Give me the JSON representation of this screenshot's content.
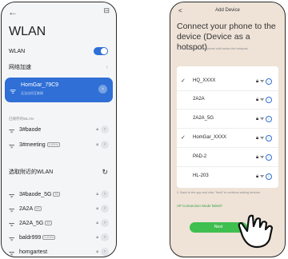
{
  "left": {
    "back_glyph": "←",
    "scan_glyph": "⊟",
    "title": "WLAN",
    "wlan_row_label": "WLAN",
    "accel_label": "网络加速",
    "connected": {
      "ssid": "HomGar_79C9",
      "sub": "无法访问互联网"
    },
    "saved_label": "已保存的WLAN",
    "saved": [
      {
        "name": "3#baode",
        "badge": ""
      },
      {
        "name": "3#meeting",
        "badge": "2.4GHz"
      }
    ],
    "nearby_label": "选取附近的WLAN",
    "nearby": [
      {
        "name": "3#baode_5G",
        "badge": "5G"
      },
      {
        "name": "2A2A",
        "badge": "5G"
      },
      {
        "name": "2A2A_5G",
        "badge": "5G"
      },
      {
        "name": "baldr999",
        "badge": "2.4GHz"
      },
      {
        "name": "homgartest",
        "badge": ""
      }
    ]
  },
  "right": {
    "header": "Add Device",
    "back_glyph": "<",
    "title": "Connect your phone to the device (Device as a hotspot)",
    "step1": "1. Please connect the phone with below the hotspots",
    "devices": [
      {
        "name": "HQ_XXXX",
        "checked": "✓"
      },
      {
        "name": "2A2A",
        "checked": ""
      },
      {
        "name": "2A2A_5G",
        "checked": ""
      },
      {
        "name": "HomGar_XXXX",
        "checked": "✓"
      },
      {
        "name": "PAD-2",
        "checked": ""
      },
      {
        "name": "HL-203",
        "checked": ""
      }
    ],
    "step2": "2. Back to the app and click \"Next\" to continue adding devices",
    "link": "AP Connection Mode failed?",
    "next_label": "Next"
  }
}
